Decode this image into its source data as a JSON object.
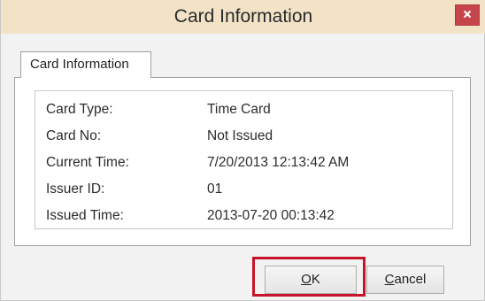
{
  "window": {
    "title": "Card Information",
    "close_icon": "close-icon",
    "accent_titlebar": "#f2e3c7",
    "close_color": "#c6454a"
  },
  "tab": {
    "label": "Card Information"
  },
  "fields": [
    {
      "label": "Card Type:",
      "value": "Time Card"
    },
    {
      "label": "Card No:",
      "value": "Not Issued"
    },
    {
      "label": "Current Time:",
      "value": "7/20/2013 12:13:42 AM"
    },
    {
      "label": "Issuer ID:",
      "value": "01"
    },
    {
      "label": "Issued Time:",
      "value": "2013-07-20 00:13:42"
    }
  ],
  "buttons": {
    "ok_mnemonic": "O",
    "ok_rest": "K",
    "cancel_mnemonic": "C",
    "cancel_rest": "ancel"
  },
  "highlight_color": "#c8142a"
}
